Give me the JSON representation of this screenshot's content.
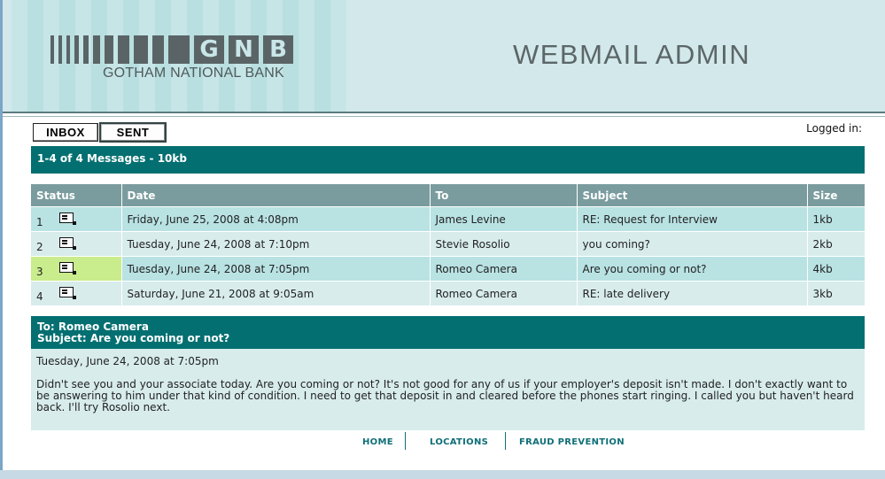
{
  "header": {
    "logo_letters": [
      "G",
      "N",
      "B"
    ],
    "bank_name": "GOTHAM NATIONAL BANK",
    "title": "WEBMAIL ADMIN"
  },
  "toolbar": {
    "inbox_label": "INBOX",
    "sent_label": "SENT",
    "active_tab": "SENT",
    "logged_in_label": "Logged in:"
  },
  "message_summary": "1-4 of 4 Messages - 10kb",
  "table": {
    "columns": [
      "Status",
      "Date",
      "To",
      "Subject",
      "Size"
    ],
    "rows": [
      {
        "num": "1",
        "date": "Friday, June 25, 2008 at 4:08pm",
        "to": "James Levine",
        "subject": "RE: Request for Interview",
        "size": "1kb"
      },
      {
        "num": "2",
        "date": "Tuesday, June 24, 2008 at 7:10pm",
        "to": "Stevie Rosolio",
        "subject": "you coming?",
        "size": "2kb"
      },
      {
        "num": "3",
        "date": "Tuesday, June 24, 2008 at 7:05pm",
        "to": "Romeo Camera",
        "subject": "Are you coming or not?",
        "size": "4kb"
      },
      {
        "num": "4",
        "date": "Saturday, June 21, 2008 at 9:05am",
        "to": "Romeo Camera",
        "subject": "RE: late delivery",
        "size": "3kb"
      }
    ],
    "selected_row": 3
  },
  "preview": {
    "to_line": "To: Romeo Camera",
    "subject_line": "Subject: Are you coming or not?",
    "date": "Tuesday, June 24, 2008 at 7:05pm",
    "body": "Didn't see you and your associate today. Are you coming or not? It's not good for any of us if your employer's deposit isn't made. I don't exactly want to be answering to him under that kind of condition. I need to get that deposit in and cleared before the phones start ringing. I called you but haven't heard back. I'll try Rosolio next."
  },
  "footer": {
    "links": [
      "HOME",
      "LOCATIONS",
      "FRAUD PREVENTION"
    ]
  },
  "colors": {
    "teal_dark": "#036f71",
    "header_gray": "#7a9c9e",
    "row_odd": "#b9e2e3",
    "row_even": "#d8ecec",
    "selected_status": "#c9ec8c",
    "footer_link": "#0f6f77"
  },
  "icons": {
    "message_status": "envelope-icon"
  }
}
